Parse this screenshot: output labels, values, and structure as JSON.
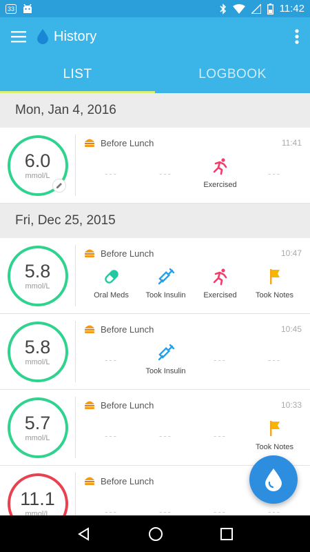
{
  "status_bar": {
    "notification_count": "33",
    "time": "11:42"
  },
  "app_bar": {
    "title": "History"
  },
  "tabs": [
    {
      "label": "LIST",
      "active": true
    },
    {
      "label": "LOGBOOK",
      "active": false
    }
  ],
  "colors": {
    "primary": "#3bb4e8",
    "in_range": "#2fd38e",
    "high": "#e8414f",
    "fab": "#2d8ee0",
    "tab_indicator": "#d7f07a"
  },
  "days": [
    {
      "date": "Mon, Jan 4, 2016",
      "entries": [
        {
          "value": "6.0",
          "unit": "mmol/L",
          "status": "in_range",
          "meal": "Before Lunch",
          "time": "11:41",
          "editable": true,
          "tags": [
            {
              "icon": "none",
              "label": "",
              "placeholder": "---"
            },
            {
              "icon": "none",
              "label": "",
              "placeholder": "---"
            },
            {
              "icon": "exercise-icon",
              "label": "Exercised"
            },
            {
              "icon": "none",
              "label": "",
              "placeholder": "---"
            }
          ]
        }
      ]
    },
    {
      "date": "Fri, Dec 25, 2015",
      "entries": [
        {
          "value": "5.8",
          "unit": "mmol/L",
          "status": "in_range",
          "meal": "Before Lunch",
          "time": "10:47",
          "tags": [
            {
              "icon": "pill-icon",
              "label": "Oral Meds"
            },
            {
              "icon": "syringe-icon",
              "label": "Took Insulin"
            },
            {
              "icon": "exercise-icon",
              "label": "Exercised"
            },
            {
              "icon": "flag-icon",
              "label": "Took Notes"
            }
          ]
        },
        {
          "value": "5.8",
          "unit": "mmol/L",
          "status": "in_range",
          "meal": "Before Lunch",
          "time": "10:45",
          "tags": [
            {
              "icon": "none",
              "label": "",
              "placeholder": "---"
            },
            {
              "icon": "syringe-icon",
              "label": "Took Insulin"
            },
            {
              "icon": "none",
              "label": "",
              "placeholder": "---"
            },
            {
              "icon": "none",
              "label": "",
              "placeholder": "---"
            }
          ]
        },
        {
          "value": "5.7",
          "unit": "mmol/L",
          "status": "in_range",
          "meal": "Before Lunch",
          "time": "10:33",
          "tags": [
            {
              "icon": "none",
              "label": "",
              "placeholder": "---"
            },
            {
              "icon": "none",
              "label": "",
              "placeholder": "---"
            },
            {
              "icon": "none",
              "label": "",
              "placeholder": "---"
            },
            {
              "icon": "flag-icon",
              "label": "Took Notes"
            }
          ]
        },
        {
          "value": "11.1",
          "unit": "mmol/L",
          "status": "high",
          "meal": "Before Lunch",
          "time": "",
          "tags": [
            {
              "icon": "none",
              "label": "",
              "placeholder": "---"
            },
            {
              "icon": "none",
              "label": "",
              "placeholder": "---"
            },
            {
              "icon": "none",
              "label": "",
              "placeholder": "---"
            },
            {
              "icon": "none",
              "label": "",
              "placeholder": "---"
            }
          ]
        }
      ]
    }
  ],
  "fab": {
    "icon": "blood-drop-icon"
  }
}
